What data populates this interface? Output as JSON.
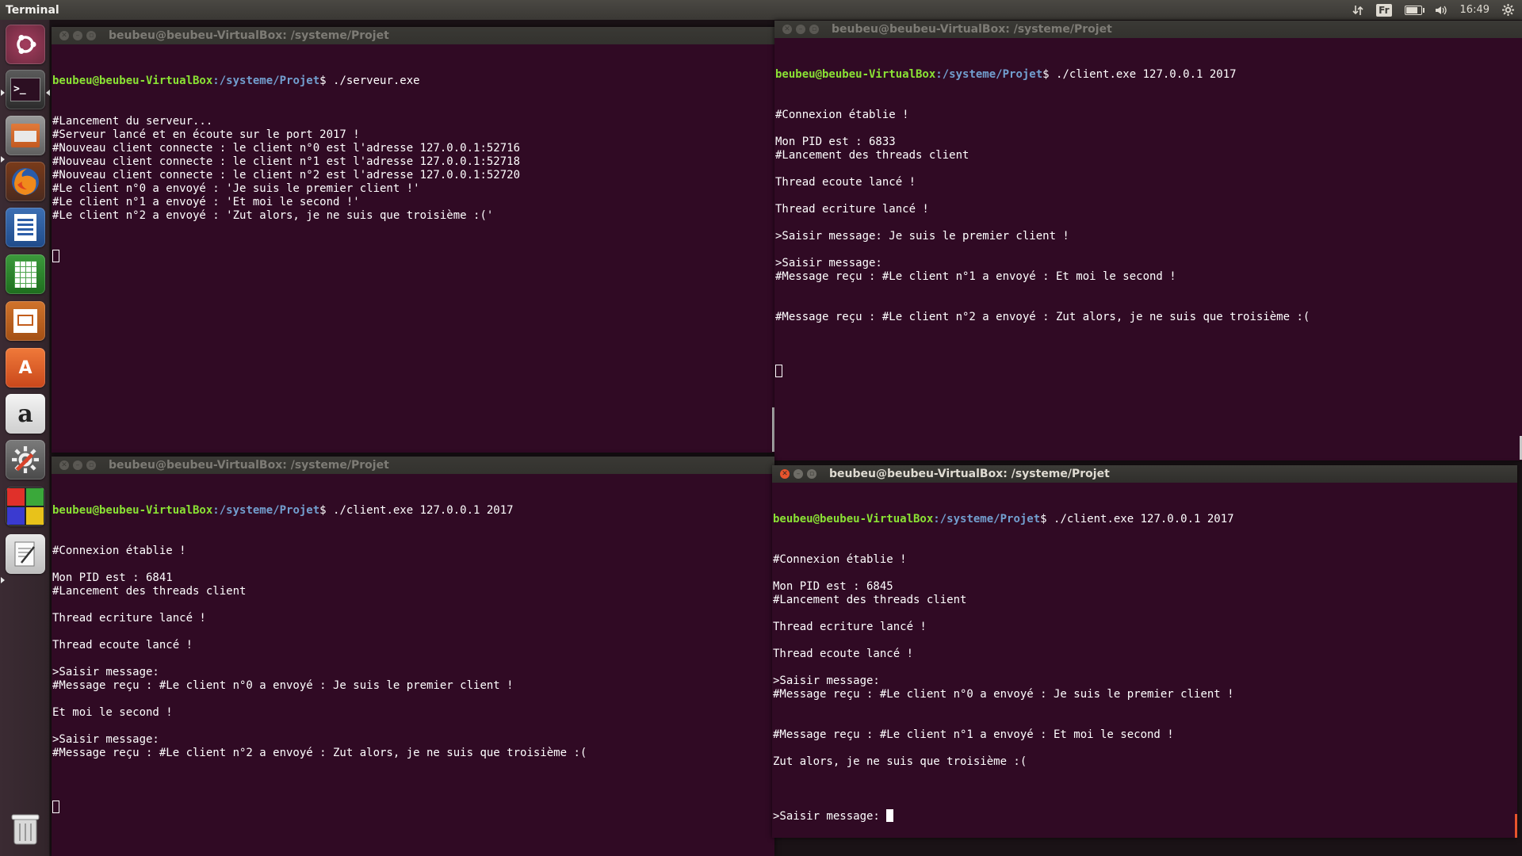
{
  "topbar": {
    "app_title": "Terminal",
    "keyboard_layout": "Fr",
    "clock": "16:49"
  },
  "launcher": {
    "items": [
      "ubuntu-dash",
      "terminal",
      "files",
      "firefox",
      "libreoffice-writer",
      "libreoffice-calc",
      "libreoffice-impress",
      "ubuntu-software",
      "amazon",
      "system-settings",
      "workspaces",
      "text-editor",
      "trash"
    ]
  },
  "windows": {
    "server": {
      "title": "beubeu@beubeu-VirtualBox: /systeme/Projet",
      "prompt_user": "beubeu@beubeu-VirtualBox",
      "prompt_path": ":/systeme/Projet",
      "prompt_cmd": "$ ./serveur.exe",
      "lines": [
        "#Lancement du serveur...",
        "#Serveur lancé et en écoute sur le port 2017 !",
        "#Nouveau client connecte : le client n°0 est l'adresse 127.0.0.1:52716",
        "#Nouveau client connecte : le client n°1 est l'adresse 127.0.0.1:52718",
        "#Nouveau client connecte : le client n°2 est l'adresse 127.0.0.1:52720",
        "#Le client n°0 a envoyé : 'Je suis le premier client !'",
        "#Le client n°1 a envoyé : 'Et moi le second !'",
        "#Le client n°2 a envoyé : 'Zut alors, je ne suis que troisième :('"
      ]
    },
    "client_top_right": {
      "title": "beubeu@beubeu-VirtualBox: /systeme/Projet",
      "prompt_user": "beubeu@beubeu-VirtualBox",
      "prompt_path": ":/systeme/Projet",
      "prompt_cmd": "$ ./client.exe 127.0.0.1 2017",
      "lines": [
        "#Connexion établie !",
        "",
        "Mon PID est : 6833",
        "#Lancement des threads client",
        "",
        "Thread ecoute lancé !",
        "",
        "Thread ecriture lancé !",
        "",
        ">Saisir message: Je suis le premier client !",
        "",
        ">Saisir message:",
        "#Message reçu : #Le client n°1 a envoyé : Et moi le second !",
        "",
        "",
        "#Message reçu : #Le client n°2 a envoyé : Zut alors, je ne suis que troisième :(",
        ""
      ]
    },
    "client_bottom_left": {
      "title": "beubeu@beubeu-VirtualBox: /systeme/Projet",
      "prompt_user": "beubeu@beubeu-VirtualBox",
      "prompt_path": ":/systeme/Projet",
      "prompt_cmd": "$ ./client.exe 127.0.0.1 2017",
      "lines": [
        "#Connexion établie !",
        "",
        "Mon PID est : 6841",
        "#Lancement des threads client",
        "",
        "Thread ecriture lancé !",
        "",
        "Thread ecoute lancé !",
        "",
        ">Saisir message:",
        "#Message reçu : #Le client n°0 a envoyé : Je suis le premier client !",
        "",
        "Et moi le second !",
        "",
        ">Saisir message:",
        "#Message reçu : #Le client n°2 a envoyé : Zut alors, je ne suis que troisième :(",
        ""
      ]
    },
    "client_bottom_right": {
      "title": "beubeu@beubeu-VirtualBox: /systeme/Projet",
      "prompt_user": "beubeu@beubeu-VirtualBox",
      "prompt_path": ":/systeme/Projet",
      "prompt_cmd": "$ ./client.exe 127.0.0.1 2017",
      "lines": [
        "#Connexion établie !",
        "",
        "Mon PID est : 6845",
        "#Lancement des threads client",
        "",
        "Thread ecriture lancé !",
        "",
        "Thread ecoute lancé !",
        "",
        ">Saisir message:",
        "#Message reçu : #Le client n°0 a envoyé : Je suis le premier client !",
        "",
        "",
        "#Message reçu : #Le client n°1 a envoyé : Et moi le second !",
        "",
        "Zut alors, je ne suis que troisième :(",
        ""
      ],
      "input_prompt": ">Saisir message: "
    }
  }
}
